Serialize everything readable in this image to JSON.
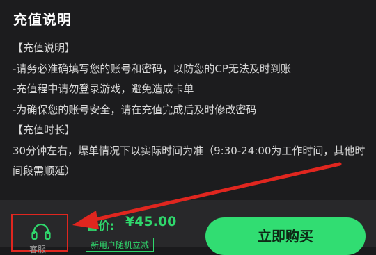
{
  "header": {
    "title": "充值说明"
  },
  "description": {
    "lines": [
      "【充值说明】",
      "-请务必准确填写您的账号和密码，以防您的CP无法及时到账",
      "-充值程中请勿登录游戏，避免造成卡单",
      "-为确保您的账号安全，请在充值完成后及时修改密码",
      "【充值时长】",
      "30分钟左右，爆单情况下以实际时间为准（9:30-24:00为工作时间，其他时间段需顺延）"
    ]
  },
  "footer": {
    "service_label": "客服",
    "price_label": "售价:",
    "price": "¥45.00",
    "promo": "新用户随机立减",
    "buy_label": "立即购买"
  },
  "colors": {
    "accent": "#31dd72",
    "annotation": "#e0261f"
  },
  "icons": {
    "service": "headset-icon"
  }
}
